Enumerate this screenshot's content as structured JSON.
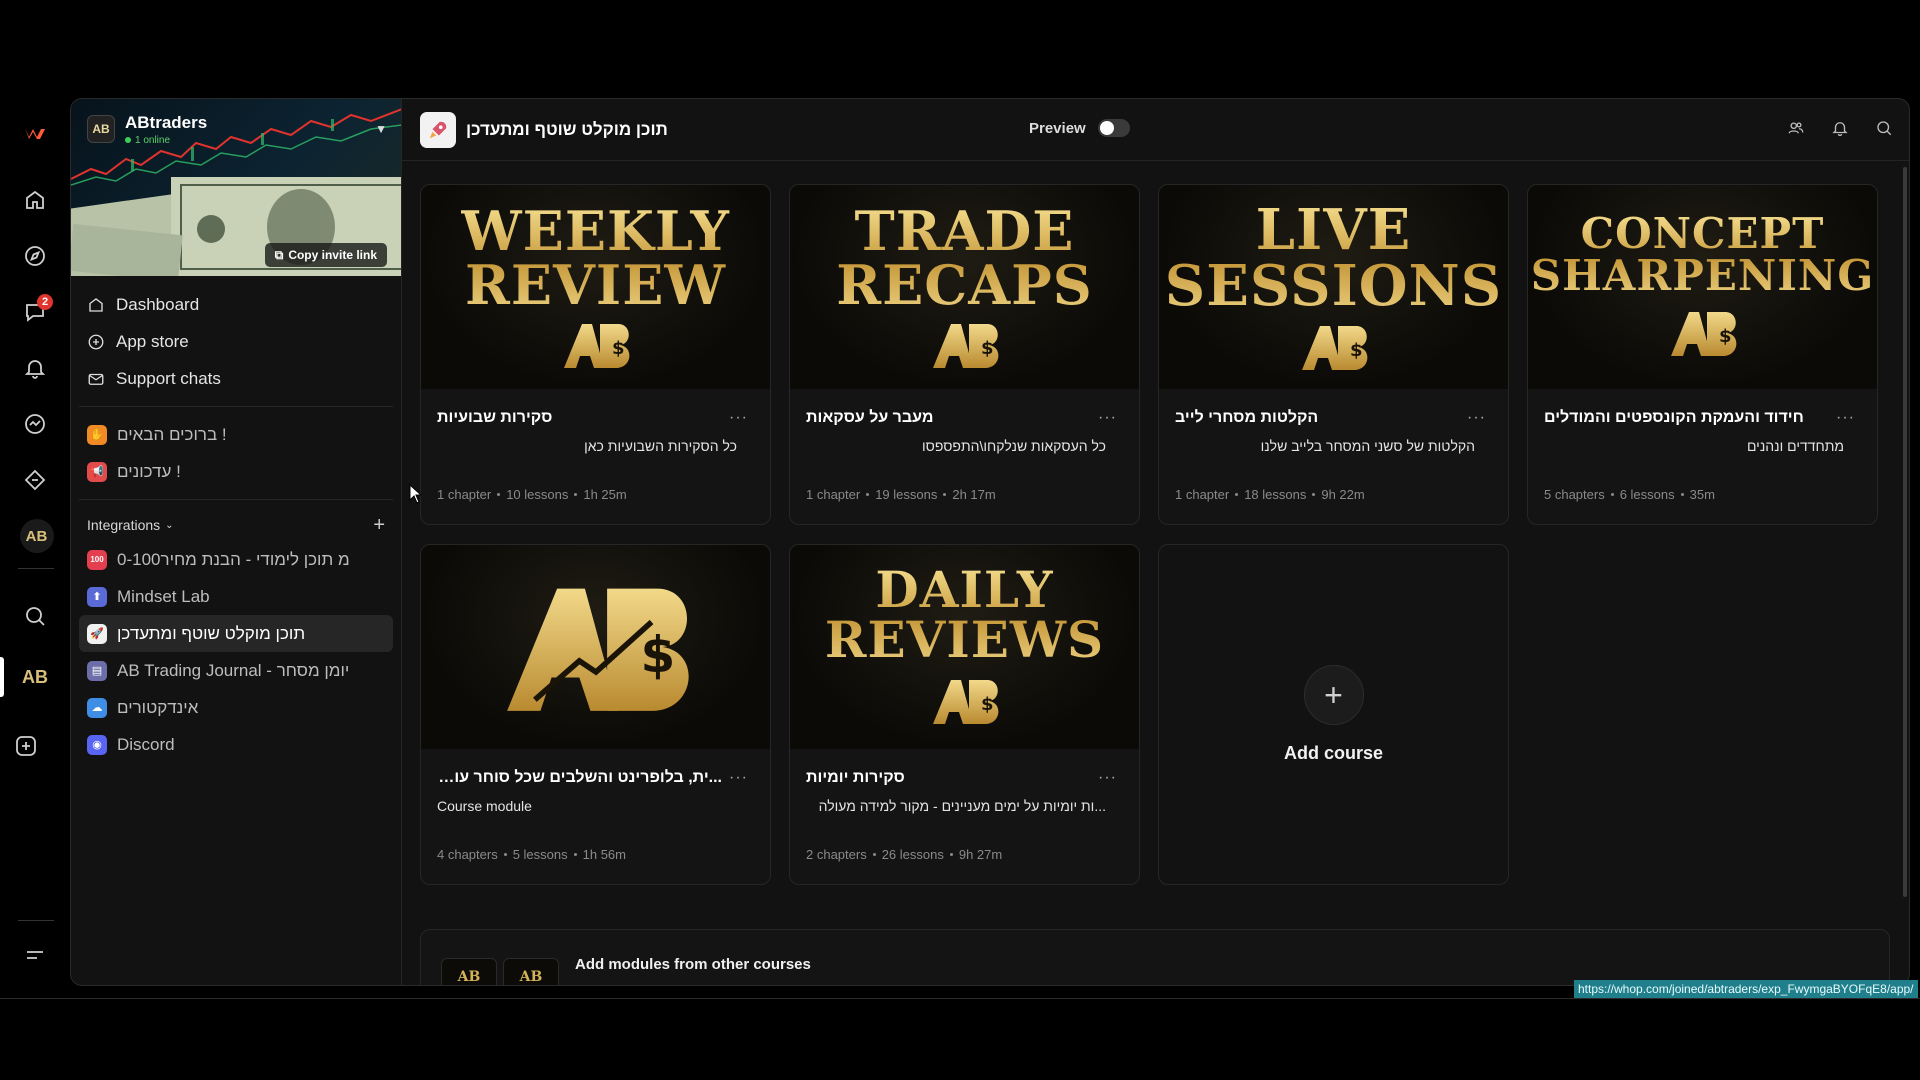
{
  "rail": {
    "logo": "whop-logo-icon",
    "icons": [
      "home-icon",
      "compass-icon",
      "chat-icon",
      "bell-icon",
      "activity-icon",
      "rocket-icon"
    ],
    "chat_badge": "2",
    "ab_label": "AB",
    "menu": "menu-icon"
  },
  "brand": {
    "name": "ABtraders",
    "logo_text": "AB",
    "online": "1 online",
    "invite": "Copy invite link"
  },
  "nav": {
    "dashboard": "Dashboard",
    "app_store": "App store",
    "support_chats": "Support chats"
  },
  "channels": [
    {
      "label": "ברוכים הבאים !",
      "icon": "wave-icon",
      "color": "#f08a24"
    },
    {
      "label": "עדכונים !",
      "icon": "megaphone-icon",
      "color": "#e24b4b"
    }
  ],
  "integrations": {
    "label": "Integrations",
    "items": [
      {
        "label": "0-100מ תוכן לימודי - הבנת מחיר",
        "color": "#e43f4f",
        "glyph": "100"
      },
      {
        "label": "Mindset Lab",
        "color": "#5a6ad6",
        "glyph": "M"
      },
      {
        "label": "תוכן מוקלט שוטף ומתעדכן",
        "color": "#f1f1f1",
        "glyph": "🚀"
      },
      {
        "label": "AB Trading Journal - יומן מסחר",
        "color": "#6b6ea8",
        "glyph": "J"
      },
      {
        "label": "אינדקטורים",
        "color": "#3f8ee6",
        "glyph": "☁"
      },
      {
        "label": "Discord",
        "color": "#5865f2",
        "glyph": "D"
      }
    ]
  },
  "header": {
    "title": "תוכן מוקלט שוטף ומתעדכן",
    "preview": "Preview"
  },
  "courses": [
    {
      "thumb": [
        "WEEKLY",
        "REVIEW"
      ],
      "title": "סקירות שבועיות",
      "sub": "כל הסקירות השבועיות כאן",
      "meta": [
        "1 chapter",
        "10 lessons",
        "1h 25m"
      ]
    },
    {
      "thumb": [
        "TRADE",
        "RECAPS"
      ],
      "title": "מעבר על עסקאות",
      "sub": "כל העסקאות שנלקחו\\התפספסו",
      "meta": [
        "1 chapter",
        "19 lessons",
        "2h 17m"
      ]
    },
    {
      "thumb": [
        "LIVE",
        "SESSIONS"
      ],
      "title": "הקלטות מסחרי לייב",
      "sub": "הקלטות של סשני המסחר בלייב שלנו",
      "meta": [
        "1 chapter",
        "18 lessons",
        "9h 22m"
      ]
    },
    {
      "thumb": [
        "CONCEPT",
        "SHARPENING"
      ],
      "title": "חידוד והעמקת הקונספטים והמודלים",
      "sub": "מתחדדים ונהנים",
      "meta": [
        "5 chapters",
        "6 lessons",
        "35m"
      ]
    },
    {
      "thumb": [],
      "title": "...ית, בלופרינט והשלבים שכל סוחר עובר",
      "sub": "Course module",
      "meta": [
        "4 chapters",
        "5 lessons",
        "1h 56m"
      ]
    },
    {
      "thumb": [
        "DAILY",
        "REVIEWS"
      ],
      "title": "סקירות יומיות",
      "sub": "...ות יומיות על ימים מעניינים - מקור למידה מעולה",
      "meta": [
        "2 chapters",
        "26 lessons",
        "9h 27m"
      ]
    }
  ],
  "add_course": "Add course",
  "modules": {
    "label": "Add modules from other courses",
    "thumbs": [
      "AB",
      "AB"
    ]
  },
  "url_hint": "https://whop.com/joined/abtraders/exp_FwymgaBYOFqE8/app/"
}
